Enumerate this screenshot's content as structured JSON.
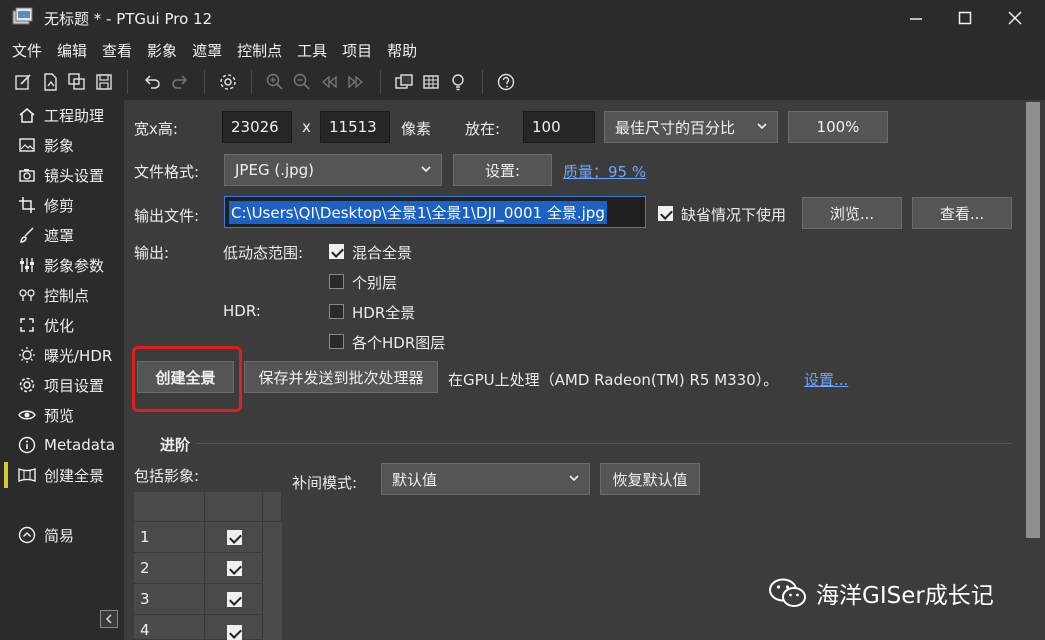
{
  "window": {
    "title": "无标题 * - PTGui Pro 12"
  },
  "menu": [
    "文件",
    "编辑",
    "查看",
    "影象",
    "遮罩",
    "控制点",
    "工具",
    "项目",
    "帮助"
  ],
  "sidebar": {
    "items": [
      {
        "label": "工程助理",
        "icon": "home-icon"
      },
      {
        "label": "影象",
        "icon": "image-icon"
      },
      {
        "label": "镜头设置",
        "icon": "camera-icon"
      },
      {
        "label": "修剪",
        "icon": "crop-icon"
      },
      {
        "label": "遮罩",
        "icon": "brush-icon"
      },
      {
        "label": "影象参数",
        "icon": "sliders-icon"
      },
      {
        "label": "控制点",
        "icon": "pins-icon"
      },
      {
        "label": "优化",
        "icon": "optimize-icon"
      },
      {
        "label": "曝光/HDR",
        "icon": "sun-icon"
      },
      {
        "label": "项目设置",
        "icon": "gear-icon"
      },
      {
        "label": "预览",
        "icon": "eye-icon"
      },
      {
        "label": "Metadata",
        "icon": "info-icon"
      },
      {
        "label": "创建全景",
        "icon": "panorama-icon"
      }
    ],
    "simple_label": "简易",
    "active_color": "#d8c93a"
  },
  "size": {
    "label": "宽x高:",
    "width": "23026",
    "x": "x",
    "height": "11513",
    "unit": "像素",
    "place_label": "放在:",
    "place_value": "100",
    "mode": "最佳尺寸的百分比",
    "percent_button": "100%"
  },
  "format": {
    "label": "文件格式:",
    "value": "JPEG (.jpg)",
    "settings_button": "设置:",
    "quality_link": "质量：95 %"
  },
  "output_file": {
    "label": "输出文件:",
    "value": "C:\\Users\\QI\\Desktop\\全景1\\全景1\\DJI_0001 全景.jpg",
    "default_checkbox": "缺省情况下使用",
    "browse_button": "浏览...",
    "view_button": "查看..."
  },
  "output": {
    "label": "输出:",
    "ldr_label": "低动态范围:",
    "blended": "混合全景",
    "layers": "个别层",
    "hdr_label": "HDR:",
    "hdr_panorama": "HDR全景",
    "hdr_layers": "各个HDR图层"
  },
  "actions": {
    "create_button": "创建全景",
    "batch_button": "保存并发送到批次处理器",
    "gpu_text": "在GPU上处理（AMD Radeon(TM) R5 M330）。",
    "gpu_settings_link": "设置...",
    "highlight_color": "#e02020"
  },
  "advanced": {
    "title": "进阶",
    "include_label": "包括影象:",
    "interp_label": "补间模式:",
    "interp_value": "默认值",
    "restore_button": "恢复默认值",
    "rows": [
      "1",
      "2",
      "3",
      "4"
    ]
  },
  "watermark": {
    "text": "海洋GISer成长记"
  }
}
